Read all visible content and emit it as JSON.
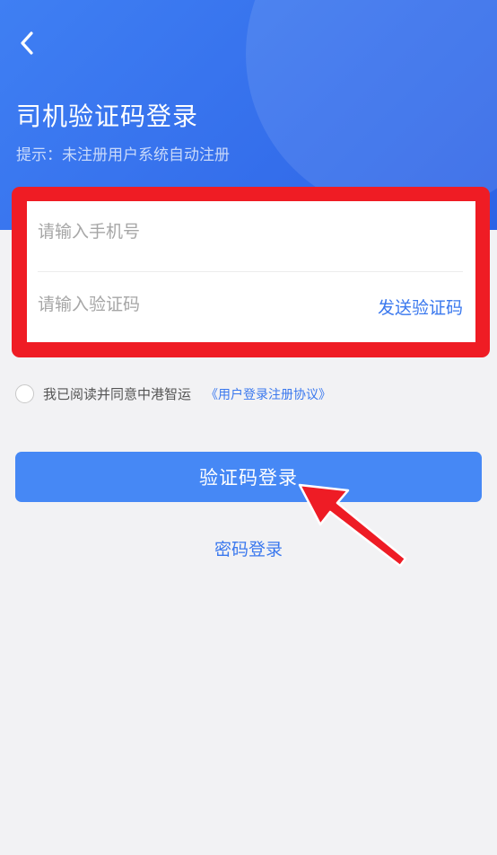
{
  "header": {
    "title": "司机验证码登录",
    "hint": "提示：未注册用户系统自动注册"
  },
  "form": {
    "phone_placeholder": "请输入手机号",
    "code_placeholder": "请输入验证码",
    "send_code_label": "发送验证码"
  },
  "agreement": {
    "text": "我已阅读并同意中港智运",
    "link_label": "《用户登录注册协议》"
  },
  "actions": {
    "login_label": "验证码登录",
    "password_login_label": "密码登录"
  },
  "colors": {
    "header_blue": "#3f7ff3",
    "button_blue": "#4688f5",
    "link_blue": "#3a78ee",
    "highlight_red": "#ef1c24"
  },
  "icons": {
    "back": "chevron-left-icon",
    "annotation": "red-arrow-icon"
  }
}
